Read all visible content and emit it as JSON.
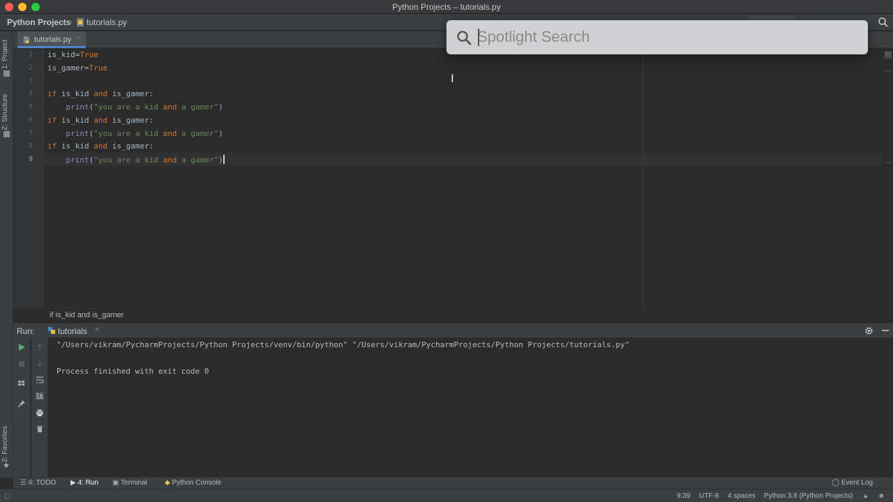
{
  "window": {
    "title": "Python Projects – tutorials.py"
  },
  "navbar": {
    "project": "Python Projects",
    "file": "tutorials.py"
  },
  "left_strip": {
    "project_tab": "1: Project",
    "structure_tab": "Z: Structure",
    "favorites_tab": "2: Favorites"
  },
  "editor": {
    "tab_label": "tutorials.py",
    "line_numbers": [
      "1",
      "2",
      "3",
      "4",
      "5",
      "6",
      "7",
      "8",
      "9"
    ],
    "current_line": "9",
    "lines": [
      {
        "code": "is_kid=True"
      },
      {
        "code": "is_gamer=True"
      },
      {
        "code": ""
      },
      {
        "code": "if is_kid and is_gamer:"
      },
      {
        "code": "    print(\"you are a kid and a gamer\")"
      },
      {
        "code": "if is_kid and is_gamer:"
      },
      {
        "code": "    print(\"you are a kid and a gamer\")"
      },
      {
        "code": "if is_kid and is_gamer:"
      },
      {
        "code": "    print(\"you are a kid and a gamer\")"
      }
    ],
    "breadcrumb": "if is_kid and is_gamer"
  },
  "spotlight": {
    "placeholder": "Spotlight Search",
    "value": ""
  },
  "run_panel": {
    "label": "Run:",
    "tab_label": "tutorials",
    "output": [
      "\"/Users/vikram/PycharmProjects/Python Projects/venv/bin/python\" \"/Users/vikram/PycharmProjects/Python Projects/tutorials.py\"",
      "",
      "Process finished with exit code 0"
    ]
  },
  "bottom_tools": {
    "todo": "6: TODO",
    "run": "4: Run",
    "terminal": "Terminal",
    "python_console": "Python Console",
    "event_log": "Event Log"
  },
  "status_bar": {
    "position": "9:39",
    "encoding": "UTF-8",
    "indent": "4 spaces",
    "interpreter": "Python 3.8 (Python Projects)"
  },
  "colors": {
    "keyword": "#cc7832",
    "string": "#6a8759",
    "background": "#2b2b2b",
    "panel": "#3c3f41",
    "run_green": "#59a869"
  }
}
